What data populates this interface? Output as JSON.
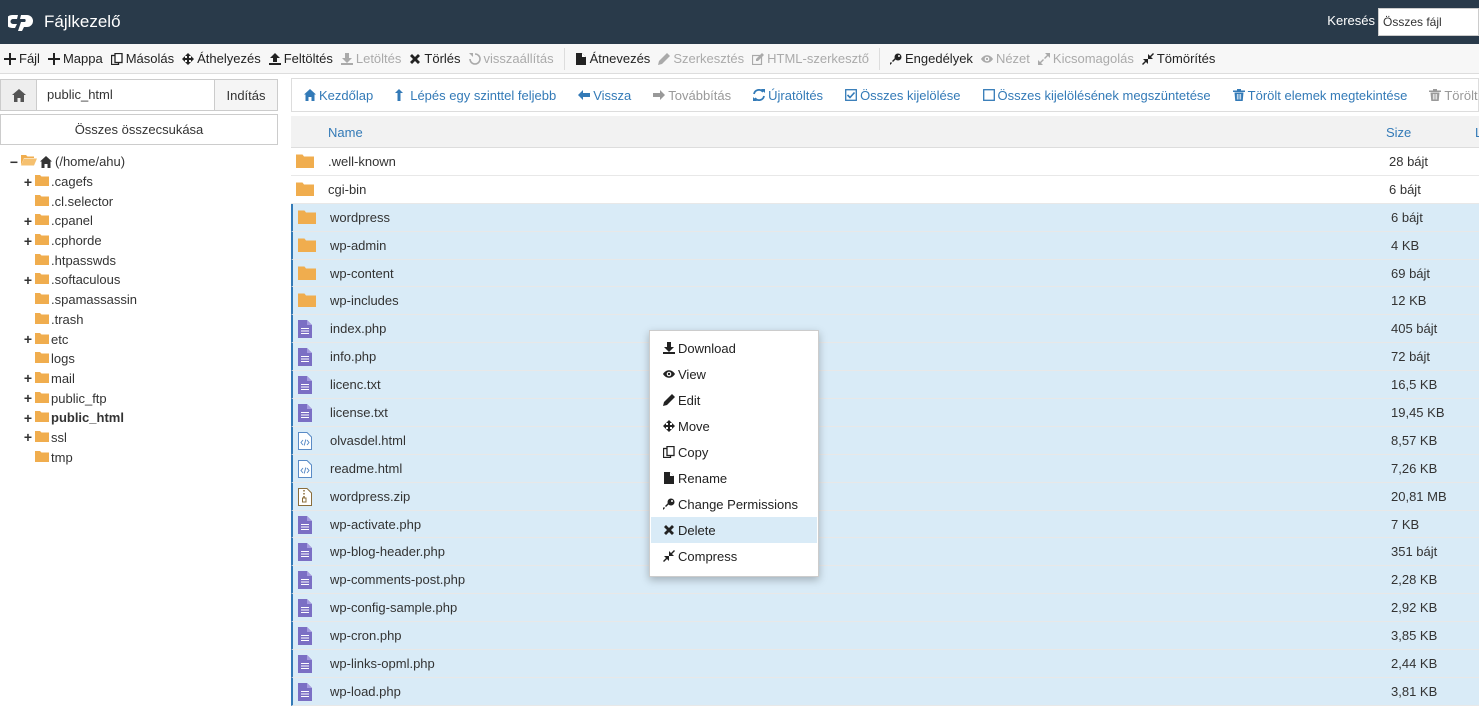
{
  "header": {
    "title": "Fájlkezelő",
    "search_label": "Keresés",
    "search_value": "Összes fájl"
  },
  "toolbar": {
    "items": [
      {
        "label": "Fájl",
        "icon": "plus-icon",
        "disabled": false
      },
      {
        "label": "Mappa",
        "icon": "plus-icon",
        "disabled": false
      },
      {
        "label": "Másolás",
        "icon": "copy-icon",
        "disabled": false
      },
      {
        "label": "Áthelyezés",
        "icon": "move-icon",
        "disabled": false
      },
      {
        "label": "Feltöltés",
        "icon": "upload-icon",
        "disabled": false
      },
      {
        "label": "Letöltés",
        "icon": "download-icon",
        "disabled": true
      },
      {
        "label": "Törlés",
        "icon": "times-icon",
        "disabled": false
      },
      {
        "label": "visszaállítás",
        "icon": "undo-icon",
        "disabled": true
      },
      {
        "label": "Átnevezés",
        "icon": "file-icon",
        "disabled": false
      },
      {
        "label": "Szerkesztés",
        "icon": "pencil-icon",
        "disabled": true
      },
      {
        "label": "HTML-szerkesztő",
        "icon": "edit-icon",
        "disabled": true
      },
      {
        "label": "Engedélyek",
        "icon": "key-icon",
        "disabled": false
      },
      {
        "label": "Nézet",
        "icon": "eye-icon",
        "disabled": true
      },
      {
        "label": "Kicsomagolás",
        "icon": "expand-icon",
        "disabled": true
      },
      {
        "label": "Tömörítés",
        "icon": "compress-icon",
        "disabled": false
      }
    ]
  },
  "sidebar": {
    "path_value": "public_html",
    "go_label": "Indítás",
    "collapse_label": "Összes összecsukása",
    "tree": [
      {
        "label": "(/home/ahu)",
        "expander": "−",
        "depth": 0,
        "bold": false
      },
      {
        "label": ".cagefs",
        "expander": "+",
        "depth": 1,
        "bold": false
      },
      {
        "label": ".cl.selector",
        "expander": "",
        "depth": 1,
        "bold": false
      },
      {
        "label": ".cpanel",
        "expander": "+",
        "depth": 1,
        "bold": false
      },
      {
        "label": ".cphorde",
        "expander": "+",
        "depth": 1,
        "bold": false
      },
      {
        "label": ".htpasswds",
        "expander": "",
        "depth": 1,
        "bold": false
      },
      {
        "label": ".softaculous",
        "expander": "+",
        "depth": 1,
        "bold": false
      },
      {
        "label": ".spamassassin",
        "expander": "",
        "depth": 1,
        "bold": false
      },
      {
        "label": ".trash",
        "expander": "",
        "depth": 1,
        "bold": false
      },
      {
        "label": "etc",
        "expander": "+",
        "depth": 1,
        "bold": false
      },
      {
        "label": "logs",
        "expander": "",
        "depth": 1,
        "bold": false
      },
      {
        "label": "mail",
        "expander": "+",
        "depth": 1,
        "bold": false
      },
      {
        "label": "public_ftp",
        "expander": "+",
        "depth": 1,
        "bold": false
      },
      {
        "label": "public_html",
        "expander": "+",
        "depth": 1,
        "bold": true
      },
      {
        "label": "ssl",
        "expander": "+",
        "depth": 1,
        "bold": false
      },
      {
        "label": "tmp",
        "expander": "",
        "depth": 1,
        "bold": false
      }
    ]
  },
  "navbar": {
    "items": [
      {
        "label": "Kezdőlap",
        "icon": "home-icon",
        "disabled": false
      },
      {
        "label": "Lépés egy szinttel feljebb",
        "icon": "level-up-icon",
        "disabled": false
      },
      {
        "label": "Vissza",
        "icon": "arrow-left-icon",
        "disabled": false
      },
      {
        "label": "Továbbítás",
        "icon": "arrow-right-icon",
        "disabled": true
      },
      {
        "label": "Újratöltés",
        "icon": "refresh-icon",
        "disabled": false
      },
      {
        "label": "Összes kijelölése",
        "icon": "check-square-icon",
        "disabled": false
      },
      {
        "label": "Összes kijelölésének megszüntetése",
        "icon": "square-icon",
        "disabled": false
      },
      {
        "label": "Törölt elemek megtekintése",
        "icon": "trash-icon",
        "disabled": false
      },
      {
        "label": "Törölt",
        "icon": "trash-icon",
        "disabled": true
      }
    ]
  },
  "table": {
    "headers": {
      "name": "Name",
      "size": "Size",
      "extra": "L"
    },
    "rows": [
      {
        "name": ".well-known",
        "size": "28 bájt",
        "type": "folder",
        "selected": false
      },
      {
        "name": "cgi-bin",
        "size": "6 bájt",
        "type": "folder",
        "selected": false
      },
      {
        "name": "wordpress",
        "size": "6 bájt",
        "type": "folder",
        "selected": true
      },
      {
        "name": "wp-admin",
        "size": "4 KB",
        "type": "folder",
        "selected": true
      },
      {
        "name": "wp-content",
        "size": "69 bájt",
        "type": "folder",
        "selected": true
      },
      {
        "name": "wp-includes",
        "size": "12 KB",
        "type": "folder",
        "selected": true
      },
      {
        "name": "index.php",
        "size": "405 bájt",
        "type": "php",
        "selected": true
      },
      {
        "name": "info.php",
        "size": "72 bájt",
        "type": "php",
        "selected": true
      },
      {
        "name": "licenc.txt",
        "size": "16,5 KB",
        "type": "php",
        "selected": true
      },
      {
        "name": "license.txt",
        "size": "19,45 KB",
        "type": "php",
        "selected": true
      },
      {
        "name": "olvasdel.html",
        "size": "8,57 KB",
        "type": "html",
        "selected": true
      },
      {
        "name": "readme.html",
        "size": "7,26 KB",
        "type": "html",
        "selected": true
      },
      {
        "name": "wordpress.zip",
        "size": "20,81 MB",
        "type": "zip",
        "selected": true
      },
      {
        "name": "wp-activate.php",
        "size": "7 KB",
        "type": "php",
        "selected": true
      },
      {
        "name": "wp-blog-header.php",
        "size": "351 bájt",
        "type": "php",
        "selected": true
      },
      {
        "name": "wp-comments-post.php",
        "size": "2,28 KB",
        "type": "php",
        "selected": true
      },
      {
        "name": "wp-config-sample.php",
        "size": "2,92 KB",
        "type": "php",
        "selected": true
      },
      {
        "name": "wp-cron.php",
        "size": "3,85 KB",
        "type": "php",
        "selected": true
      },
      {
        "name": "wp-links-opml.php",
        "size": "2,44 KB",
        "type": "php",
        "selected": true
      },
      {
        "name": "wp-load.php",
        "size": "3,81 KB",
        "type": "php",
        "selected": true
      }
    ]
  },
  "context_menu": {
    "items": [
      {
        "label": "Download",
        "icon": "download-icon",
        "active": false
      },
      {
        "label": "View",
        "icon": "eye-icon",
        "active": false
      },
      {
        "label": "Edit",
        "icon": "pencil-icon",
        "active": false
      },
      {
        "label": "Move",
        "icon": "move-icon",
        "active": false
      },
      {
        "label": "Copy",
        "icon": "copy-icon",
        "active": false
      },
      {
        "label": "Rename",
        "icon": "file-icon",
        "active": false
      },
      {
        "label": "Change Permissions",
        "icon": "key-icon",
        "active": false
      },
      {
        "label": "Delete",
        "icon": "times-icon",
        "active": true
      },
      {
        "label": "Compress",
        "icon": "compress-icon",
        "active": false
      }
    ]
  },
  "colors": {
    "header_bg": "#293a4a",
    "link_blue": "#337ab7",
    "selected_row": "#d9ebf7",
    "folder": "#f0ad4e",
    "php_file": "#7b6fc4"
  }
}
